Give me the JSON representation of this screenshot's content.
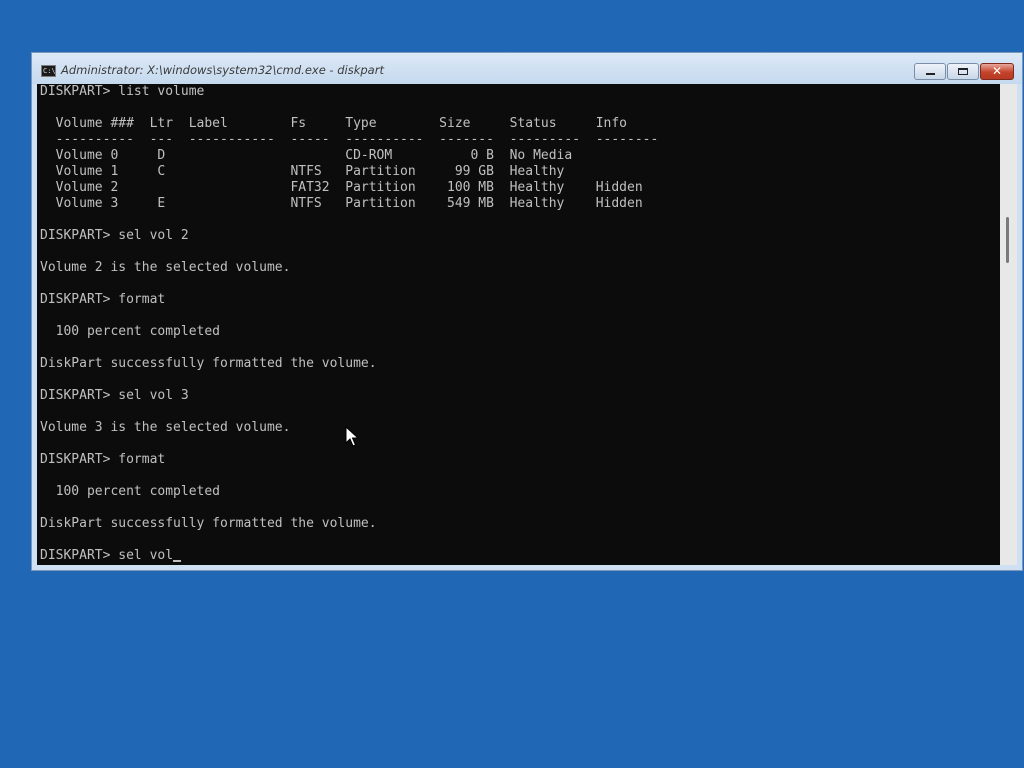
{
  "window": {
    "title": "Administrator: X:\\windows\\system32\\cmd.exe - diskpart",
    "icon_label": "C:\\",
    "close_glyph": "✕"
  },
  "console": {
    "lines": [
      "DISKPART> list volume",
      "",
      "  Volume ###  Ltr  Label        Fs     Type        Size     Status     Info",
      "  ----------  ---  -----------  -----  ----------  -------  ---------  --------",
      "  Volume 0     D                       CD-ROM          0 B  No Media",
      "  Volume 1     C                NTFS   Partition     99 GB  Healthy",
      "  Volume 2                      FAT32  Partition    100 MB  Healthy    Hidden",
      "  Volume 3     E                NTFS   Partition    549 MB  Healthy    Hidden",
      "",
      "DISKPART> sel vol 2",
      "",
      "Volume 2 is the selected volume.",
      "",
      "DISKPART> format",
      "",
      "  100 percent completed",
      "",
      "DiskPart successfully formatted the volume.",
      "",
      "DISKPART> sel vol 3",
      "",
      "Volume 3 is the selected volume.",
      "",
      "DISKPART> format",
      "",
      "  100 percent completed",
      "",
      "DiskPart successfully formatted the volume.",
      ""
    ],
    "prompt_line": "DISKPART> sel vol"
  },
  "icons": {
    "app": "cmd-icon",
    "minimize": "minimize-icon",
    "maximize": "maximize-icon",
    "close": "close-icon",
    "pointer": "mouse-pointer-icon"
  },
  "colors": {
    "desktop": "#2068b6",
    "console_bg": "#0c0c0c",
    "console_text": "#c0c0c0",
    "close_button": "#c4432b"
  }
}
